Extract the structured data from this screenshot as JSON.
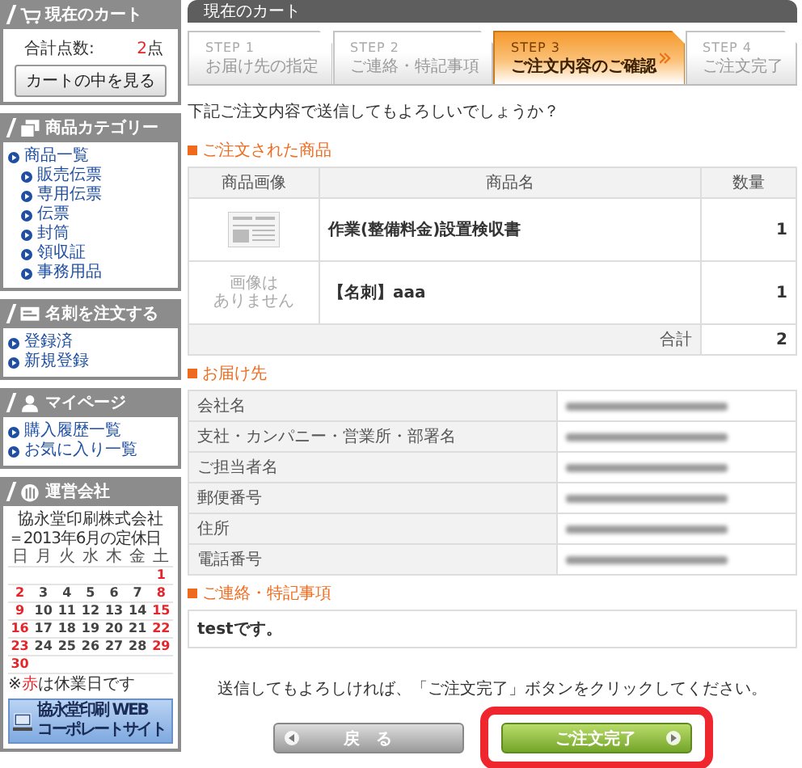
{
  "sidebar": {
    "cart": {
      "title": "現在のカート",
      "total_label": "合計点数:",
      "total_count": "2",
      "total_unit": "点",
      "button": "カートの中を見る"
    },
    "categories": {
      "title": "商品カテゴリー",
      "items": [
        {
          "label": "商品一覧",
          "children": [
            {
              "label": "販売伝票"
            },
            {
              "label": "専用伝票"
            },
            {
              "label": "伝票"
            },
            {
              "label": "封筒"
            },
            {
              "label": "領収証"
            },
            {
              "label": "事務用品"
            }
          ]
        }
      ]
    },
    "business_cards": {
      "title": "名刺を注文する",
      "items": [
        "登録済",
        "新規登録"
      ]
    },
    "my_page": {
      "title": "マイページ",
      "items": [
        "購入履歴一覧",
        "お気に入り一覧"
      ]
    },
    "company": {
      "title": "運営会社",
      "name": "協永堂印刷株式会社",
      "calendar_title": "＝2013年6月の定休日",
      "weekdays": [
        "日",
        "月",
        "火",
        "水",
        "木",
        "金",
        "土"
      ],
      "weeks": [
        {
          "kind": "tail",
          "days": [
            {
              "day": "1",
              "holiday": true
            }
          ]
        },
        {
          "kind": "head",
          "days": [
            {
              "day": "2",
              "holiday": true
            },
            {
              "day": "3",
              "holiday": false
            },
            {
              "day": "4",
              "holiday": false
            },
            {
              "day": "5",
              "holiday": false
            },
            {
              "day": "6",
              "holiday": false
            },
            {
              "day": "7",
              "holiday": false
            },
            {
              "day": "8",
              "holiday": true
            }
          ]
        },
        {
          "kind": "head",
          "days": [
            {
              "day": "9",
              "holiday": true
            },
            {
              "day": "10",
              "holiday": false
            },
            {
              "day": "11",
              "holiday": false
            },
            {
              "day": "12",
              "holiday": false
            },
            {
              "day": "13",
              "holiday": false
            },
            {
              "day": "14",
              "holiday": false
            },
            {
              "day": "15",
              "holiday": true
            }
          ]
        },
        {
          "kind": "head",
          "days": [
            {
              "day": "16",
              "holiday": true
            },
            {
              "day": "17",
              "holiday": false
            },
            {
              "day": "18",
              "holiday": false
            },
            {
              "day": "19",
              "holiday": false
            },
            {
              "day": "20",
              "holiday": false
            },
            {
              "day": "21",
              "holiday": false
            },
            {
              "day": "22",
              "holiday": true
            }
          ]
        },
        {
          "kind": "head",
          "days": [
            {
              "day": "23",
              "holiday": true
            },
            {
              "day": "24",
              "holiday": false
            },
            {
              "day": "25",
              "holiday": false
            },
            {
              "day": "26",
              "holiday": false
            },
            {
              "day": "27",
              "holiday": false
            },
            {
              "day": "28",
              "holiday": false
            },
            {
              "day": "29",
              "holiday": true
            }
          ]
        },
        {
          "kind": "head",
          "days": [
            {
              "day": "30",
              "holiday": true
            }
          ]
        }
      ],
      "note": {
        "before": "※",
        "highlight": "赤",
        "after": "は休業日です"
      },
      "banner": [
        "協永堂印刷 WEB",
        "コーポレートサイト"
      ]
    }
  },
  "main": {
    "title": "現在のカート",
    "steps": [
      {
        "step": "STEP 1",
        "label": "お届け先の指定",
        "selected": false
      },
      {
        "step": "STEP 2",
        "label": "ご連絡・特記事項",
        "selected": false
      },
      {
        "step": "STEP 3",
        "label": "ご注文内容のご確認",
        "selected": true
      },
      {
        "step": "STEP 4",
        "label": "ご注文完了",
        "selected": false
      }
    ],
    "notice": "下記ご注文内容で送信してもよろしいでしょうか？",
    "ordered": {
      "heading": "ご注文された商品",
      "columns": [
        "商品画像",
        "商品名",
        "数量"
      ],
      "rows": [
        {
          "name": "作業(整備料金)設置検収書",
          "quantity": "1"
        },
        {
          "image": {
            "kind": "none",
            "text": [
              "画像は",
              "ありません"
            ]
          },
          "name": "【名刺】aaa",
          "quantity": "1"
        }
      ],
      "total_label": "合計",
      "total": "2"
    },
    "delivery": {
      "heading": "お届け先",
      "rows": [
        {
          "label": "会社名",
          "redacted": true
        },
        {
          "label": "支社・カンパニー・営業所・部署名",
          "redacted": true
        },
        {
          "label": "ご担当者名",
          "redacted": true
        },
        {
          "label": "郵便番号",
          "redacted": true
        },
        {
          "label": "住所",
          "redacted": true
        },
        {
          "label": "電話番号",
          "redacted": true
        }
      ]
    },
    "remarks": {
      "heading": "ご連絡・特記事項",
      "text": "testです。"
    },
    "confirm_text": "送信してもよろしければ、「ご注文完了」ボタンをクリックしてください。",
    "buttons": [
      {
        "kind": "back",
        "label": "戻　る",
        "highlighted": false
      },
      {
        "kind": "submit",
        "label": "ご注文完了",
        "highlighted": true
      }
    ]
  }
}
